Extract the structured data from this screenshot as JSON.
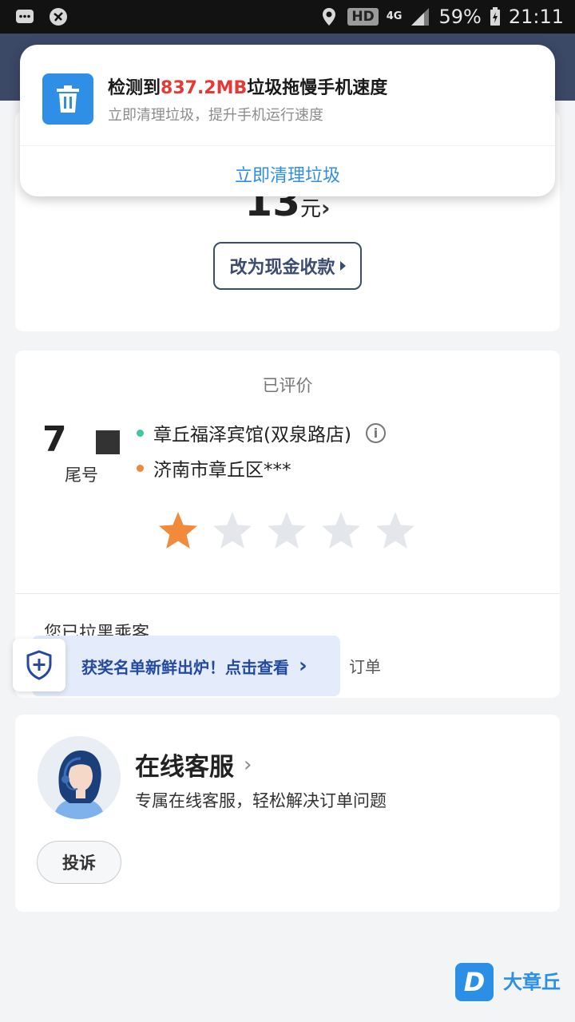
{
  "status_bar": {
    "battery_percent": "59%",
    "time": "21:11",
    "hd_badge": "HD",
    "network": "4G"
  },
  "notification": {
    "title_prefix": "检测到",
    "title_highlight": "837.2MB",
    "title_suffix": "垃圾拖慢手机速度",
    "subtitle": "立即清理垃圾，提升手机运行速度",
    "action": "立即清理垃圾",
    "highlight_color": "#e53935",
    "accent_color": "#2f8ee6",
    "icon": "trash-icon"
  },
  "payment": {
    "amount": "13",
    "unit": "元",
    "cash_button": "改为现金收款"
  },
  "rating": {
    "status": "已评价",
    "plate_partial": "7",
    "plate_label": "尾号",
    "pickup": "章丘福泽宾馆(双泉路店)",
    "destination": "济南市章丘区***",
    "stars_filled": 1,
    "stars_total": 5,
    "blacklist_text": "您已拉黑乘客",
    "order_text": "订单"
  },
  "promo": {
    "text": "获奖名单新鲜出炉！点击查看",
    "chevron": "›"
  },
  "service": {
    "title": "在线客服",
    "subtitle": "专属在线客服，轻松解决订单问题",
    "complaint_button": "投诉"
  },
  "watermark": {
    "logo_letter": "D",
    "text": "大章丘"
  }
}
